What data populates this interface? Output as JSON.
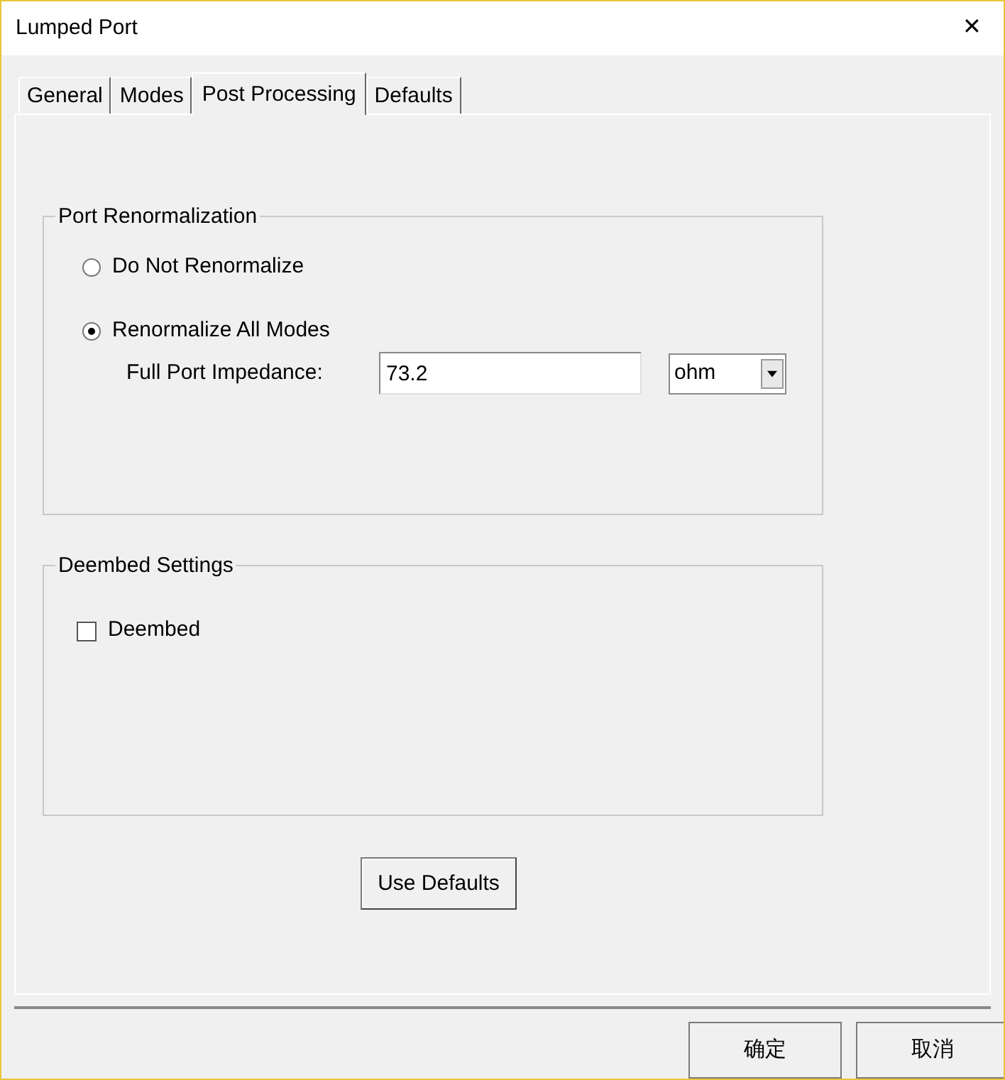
{
  "window": {
    "title": "Lumped Port",
    "close": "✕"
  },
  "tabs": [
    {
      "label": "General",
      "selected": false
    },
    {
      "label": "Modes",
      "selected": false
    },
    {
      "label": "Post Processing",
      "selected": true
    },
    {
      "label": "Defaults",
      "selected": false
    }
  ],
  "port_renormalization": {
    "title": "Port Renormalization",
    "options": [
      {
        "label": "Do Not Renormalize",
        "selected": false
      },
      {
        "label": "Renormalize All Modes",
        "selected": true
      }
    ],
    "impedance": {
      "label": "Full Port Impedance:",
      "value": "73.2",
      "unit": "ohm"
    }
  },
  "deembed_settings": {
    "title": "Deembed Settings",
    "deembed": {
      "label": "Deembed",
      "checked": false
    }
  },
  "use_defaults": "Use Defaults",
  "buttons": [
    "确定",
    "取消"
  ]
}
